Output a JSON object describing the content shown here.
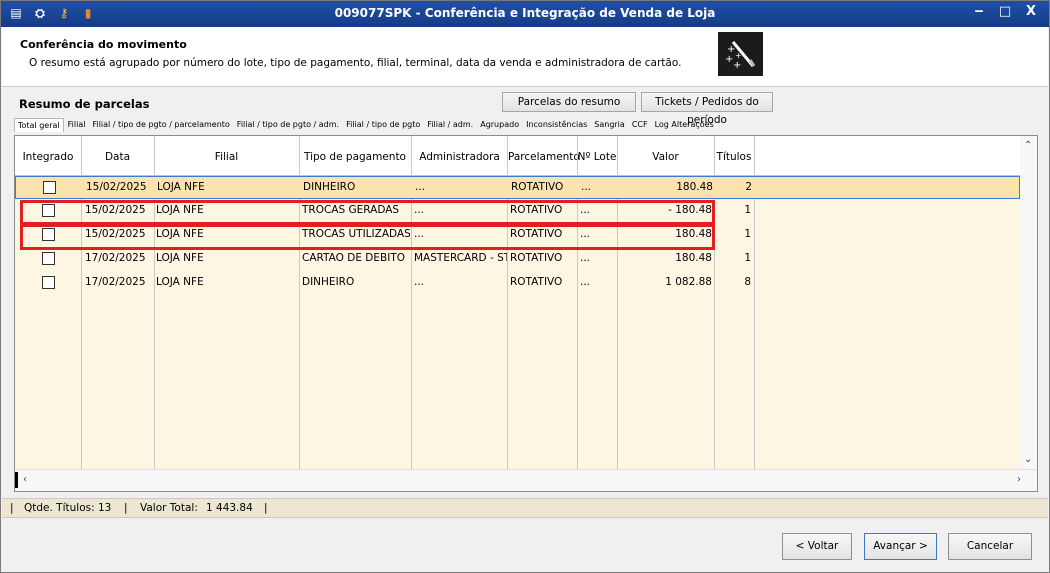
{
  "window": {
    "title": "009077SPK - Conferência e Integração de Venda de Loja",
    "controls": {
      "minimize": "‒",
      "maximize": "□",
      "close": "X"
    }
  },
  "header": {
    "title": "Conferência do movimento",
    "description": "O resumo está agrupado por número do lote, tipo de pagamento, filial, terminal, data da venda e administradora de cartão."
  },
  "section": {
    "title": "Resumo de parcelas",
    "btn_parcelas": "Parcelas do resumo",
    "btn_tickets": "Tickets / Pedidos do período"
  },
  "tabs": [
    {
      "label": "Total geral"
    },
    {
      "label": "Filial"
    },
    {
      "label": "Filial / tipo de pgto / parcelamento"
    },
    {
      "label": "Filial / tipo de pgto / adm."
    },
    {
      "label": "Filial / tipo de pgto"
    },
    {
      "label": "Filial / adm."
    },
    {
      "label": "Agrupado"
    },
    {
      "label": "Inconsistências"
    },
    {
      "label": "Sangria"
    },
    {
      "label": "CCF"
    },
    {
      "label": "Log Alterações"
    }
  ],
  "table": {
    "headers": {
      "integrado": "Integrado",
      "data": "Data",
      "filial": "Filial",
      "tipo": "Tipo de pagamento",
      "administradora": "Administradora",
      "parcelamento": "Parcelamento",
      "lote": "Nº Lote",
      "valor": "Valor",
      "titulos": "Títulos"
    },
    "rows": [
      {
        "data": "15/02/2025",
        "filial": "LOJA NFE",
        "tipo": "DINHEIRO",
        "administradora": "...",
        "parcelamento": "ROTATIVO",
        "lote": "...",
        "valor": "180.48",
        "titulos": "2"
      },
      {
        "data": "15/02/2025",
        "filial": "LOJA NFE",
        "tipo": "TROCAS GERADAS",
        "administradora": "...",
        "parcelamento": "ROTATIVO",
        "lote": "...",
        "valor": "- 180.48",
        "titulos": "1"
      },
      {
        "data": "15/02/2025",
        "filial": "LOJA NFE",
        "tipo": "TROCAS UTILIZADAS",
        "administradora": "...",
        "parcelamento": "ROTATIVO",
        "lote": "...",
        "valor": "180.48",
        "titulos": "1"
      },
      {
        "data": "17/02/2025",
        "filial": "LOJA NFE",
        "tipo": "CARTAO DE DEBITO",
        "administradora": "MASTERCARD - STC",
        "parcelamento": "ROTATIVO",
        "lote": "...",
        "valor": "180.48",
        "titulos": "1"
      },
      {
        "data": "17/02/2025",
        "filial": "LOJA NFE",
        "tipo": "DINHEIRO",
        "administradora": "...",
        "parcelamento": "ROTATIVO",
        "lote": "...",
        "valor": "1 082.88",
        "titulos": "8"
      }
    ]
  },
  "status": {
    "qtde_label": "Qtde. Títulos:",
    "qtde_value": "13",
    "valor_label": "Valor Total:",
    "valor_value": "1 443.84"
  },
  "footer": {
    "voltar": "< Voltar",
    "avancar": "Avançar >",
    "cancelar": "Cancelar"
  },
  "colors": {
    "titlebar": "#1f4fa6",
    "grid_bg": "#fdf6e3",
    "selected_row": "#fbe3ad",
    "highlight_border": "#e02020"
  }
}
